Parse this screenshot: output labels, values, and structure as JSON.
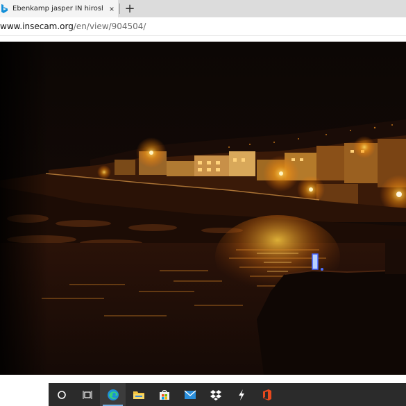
{
  "browser": {
    "tab": {
      "title": "Ebenkamp jasper IN hiroshima s",
      "close_glyph": "×",
      "favicon": "bing-b-icon"
    },
    "new_tab_glyph": "+",
    "address": {
      "host": "www.insecam.org",
      "path": "/en/view/904504/"
    }
  },
  "content": {
    "image": "night-webcam-coastal-town",
    "colors": {
      "sky": "#0d0806",
      "light_orange": "#ffb020",
      "sea": "#1a0c06"
    }
  },
  "taskbar": {
    "items": [
      {
        "icon": "cortana-circle-icon"
      },
      {
        "icon": "task-view-icon"
      },
      {
        "icon": "edge-browser-icon",
        "active": true
      },
      {
        "icon": "file-explorer-icon"
      },
      {
        "icon": "microsoft-store-icon"
      },
      {
        "icon": "mail-icon"
      },
      {
        "icon": "dropbox-icon"
      },
      {
        "icon": "lightning-app-icon"
      },
      {
        "icon": "office-icon"
      }
    ]
  }
}
